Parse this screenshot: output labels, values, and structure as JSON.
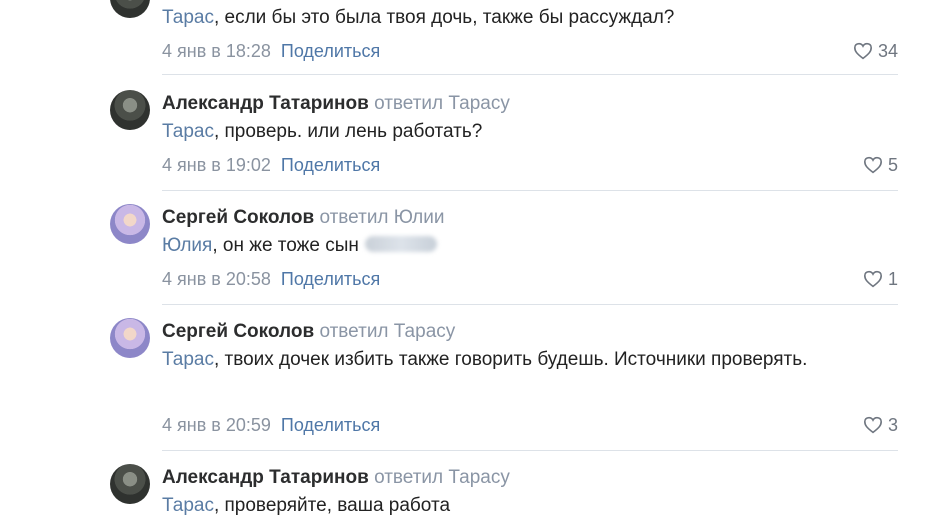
{
  "comments": [
    {
      "author": "",
      "reply": "",
      "mention": "Тарас",
      "text_rest": ", если бы это была твоя дочь, также бы рассуждал?",
      "date": "4 янв в 18:28",
      "share_label": "Поделиться",
      "likes": "34",
      "avatar": "dark"
    },
    {
      "author": "Александр Татаринов",
      "reply": "ответил Тарасу",
      "mention": "Тарас",
      "text_rest": ", проверь. или лень работать?",
      "date": "4 янв в 19:02",
      "share_label": "Поделиться",
      "likes": "5",
      "avatar": "dark"
    },
    {
      "author": "Сергей Соколов",
      "reply": "ответил Юлии",
      "mention": "Юлия",
      "text_rest": ", он же тоже сын",
      "date": "4 янв в 20:58",
      "share_label": "Поделиться",
      "likes": "1",
      "avatar": "light"
    },
    {
      "author": "Сергей Соколов",
      "reply": "ответил Тарасу",
      "mention": "Тарас",
      "text_rest": ", твоих дочек избить также говорить будешь. Источники проверять.",
      "date": "4 янв в 20:59",
      "share_label": "Поделиться",
      "likes": "3",
      "avatar": "light"
    },
    {
      "author": "Александр Татаринов",
      "reply": "ответил Тарасу",
      "mention": "Тарас",
      "text_rest": ", проверяйте, ваша работа",
      "date": "",
      "share_label": "",
      "likes": "",
      "avatar": "dark"
    }
  ],
  "colors": {
    "mention": "#5a7ca4",
    "reply": "#8a95a5",
    "share": "#4f77a7",
    "meta": "#8a93a0",
    "divider": "#dde2e8"
  },
  "icons": {
    "like": "heart-icon"
  }
}
